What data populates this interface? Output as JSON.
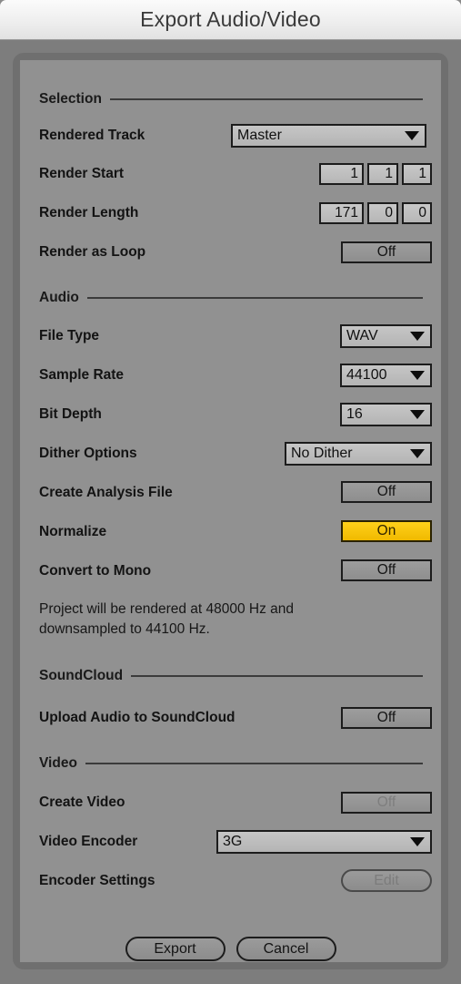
{
  "window": {
    "title": "Export Audio/Video"
  },
  "sections": {
    "selection": {
      "title": "Selection",
      "rendered_track": {
        "label": "Rendered Track",
        "value": "Master"
      },
      "render_start": {
        "label": "Render Start",
        "values": [
          "1",
          "1",
          "1"
        ]
      },
      "render_length": {
        "label": "Render Length",
        "values": [
          "171",
          "0",
          "0"
        ]
      },
      "render_as_loop": {
        "label": "Render as Loop",
        "value": "Off"
      }
    },
    "audio": {
      "title": "Audio",
      "file_type": {
        "label": "File Type",
        "value": "WAV"
      },
      "sample_rate": {
        "label": "Sample Rate",
        "value": "44100"
      },
      "bit_depth": {
        "label": "Bit Depth",
        "value": "16"
      },
      "dither_options": {
        "label": "Dither Options",
        "value": "No Dither"
      },
      "create_analysis_file": {
        "label": "Create Analysis File",
        "value": "Off"
      },
      "normalize": {
        "label": "Normalize",
        "value": "On"
      },
      "convert_to_mono": {
        "label": "Convert to Mono",
        "value": "Off"
      },
      "note_line1": "Project will be rendered at 48000 Hz and",
      "note_line2": "downsampled to 44100 Hz."
    },
    "soundcloud": {
      "title": "SoundCloud",
      "upload_audio": {
        "label": "Upload Audio to SoundCloud",
        "value": "Off"
      }
    },
    "video": {
      "title": "Video",
      "create_video": {
        "label": "Create Video",
        "value": "Off"
      },
      "video_encoder": {
        "label": "Video Encoder",
        "value": "3G"
      },
      "encoder_settings": {
        "label": "Encoder Settings",
        "value": "Edit"
      }
    }
  },
  "footer": {
    "export_label": "Export",
    "cancel_label": "Cancel"
  },
  "colors": {
    "accent_on": "#f0b900",
    "panel": "#919191",
    "frame": "#6f6f6f",
    "titlebar": "#f0f0f0"
  }
}
